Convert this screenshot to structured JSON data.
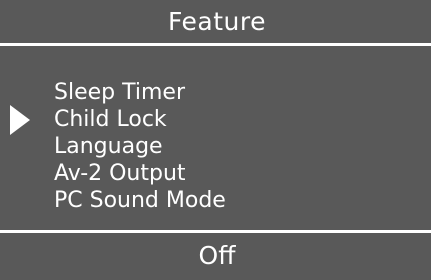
{
  "menu": {
    "title": "Feature",
    "items": [
      {
        "label": "Sleep Timer"
      },
      {
        "label": "Child Lock"
      },
      {
        "label": "Language"
      },
      {
        "label": "Av-2 Output"
      },
      {
        "label": "PC Sound Mode"
      }
    ],
    "selected_index": 1,
    "current_value": "Off"
  },
  "colors": {
    "background": "#595959",
    "text": "#ffffff",
    "accent_lines": "#ffffff"
  },
  "icons": {
    "selection_pointer": "triangle-right-icon"
  }
}
